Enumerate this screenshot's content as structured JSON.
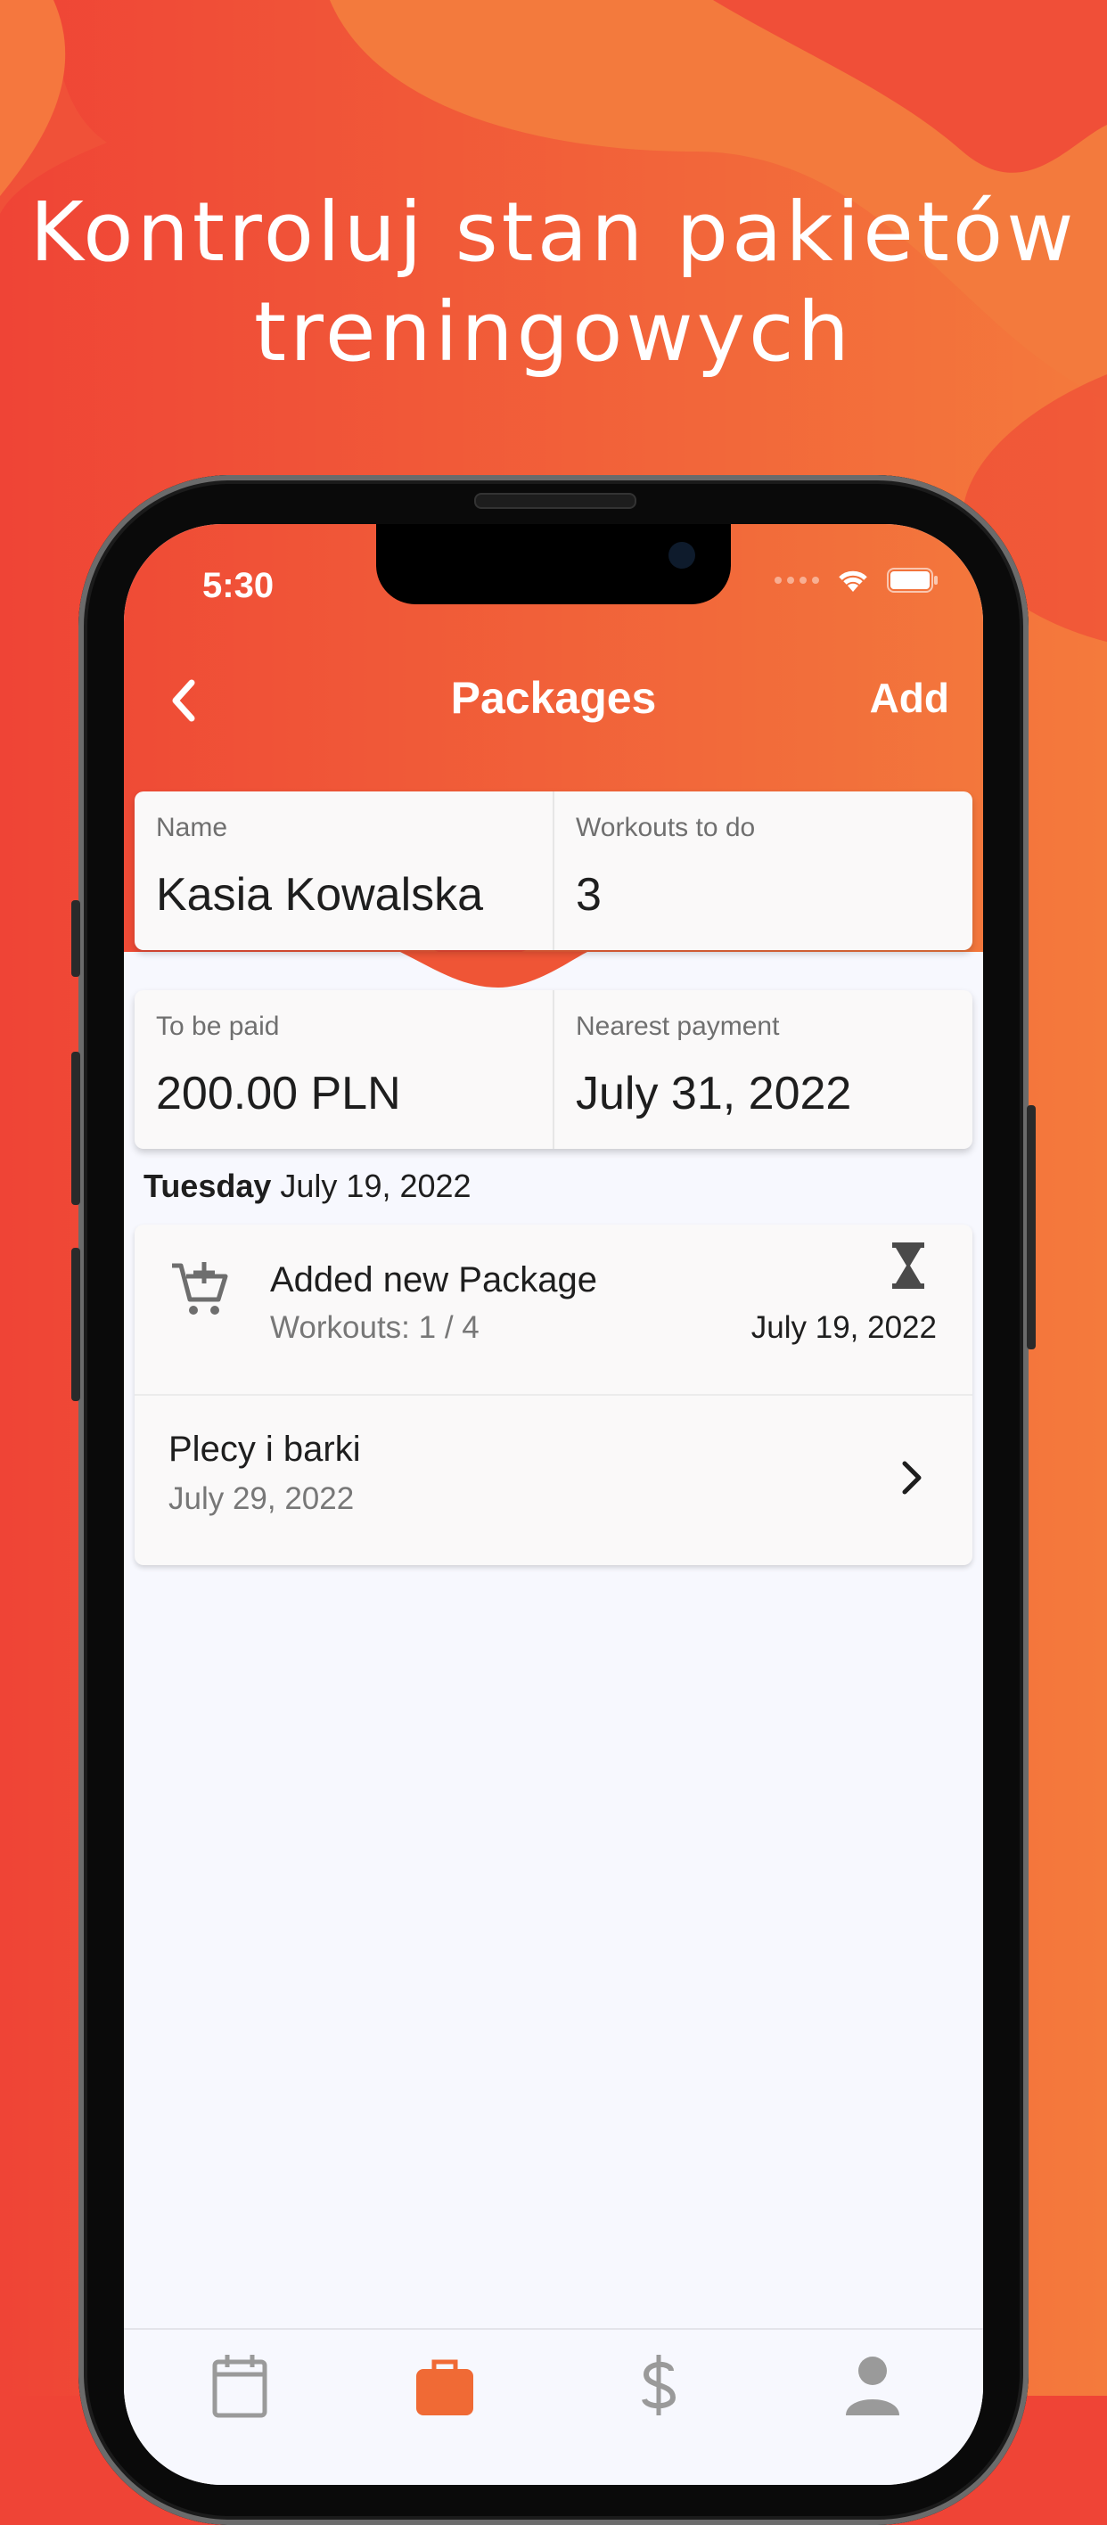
{
  "headline": {
    "line1": "Kontroluj stan pakietów",
    "line2": "treningowych"
  },
  "status": {
    "time": "5:30"
  },
  "navbar": {
    "title": "Packages",
    "add_label": "Add"
  },
  "info_cards": {
    "name_label": "Name",
    "name_value": "Kasia Kowalska",
    "workouts_label": "Workouts to do",
    "workouts_value": "3",
    "to_pay_label": "To be paid",
    "to_pay_value": "200.00 PLN",
    "nearest_label": "Nearest payment",
    "nearest_value": "July 31, 2022"
  },
  "section": {
    "weekday": "Tuesday",
    "date": "July 19, 2022"
  },
  "items": [
    {
      "title": "Added new Package",
      "subtitle": "Workouts: 1 / 4",
      "date": "July 19, 2022",
      "icon": "cart-plus-icon",
      "status_icon": "hourglass-icon"
    },
    {
      "title": "Plecy i barki",
      "subtitle": "July 29, 2022",
      "icon": "chevron-right-icon"
    }
  ],
  "tabs": [
    {
      "name": "calendar",
      "icon": "calendar-icon",
      "active": false
    },
    {
      "name": "packages",
      "icon": "briefcase-icon",
      "active": true
    },
    {
      "name": "payments",
      "icon": "dollar-icon",
      "active": false
    },
    {
      "name": "profile",
      "icon": "person-icon",
      "active": false
    }
  ],
  "colors": {
    "primary": "#f06a35",
    "background_red": "#ef4436",
    "background_orange": "#f47a3c",
    "tab_inactive": "#9a9a9a"
  }
}
